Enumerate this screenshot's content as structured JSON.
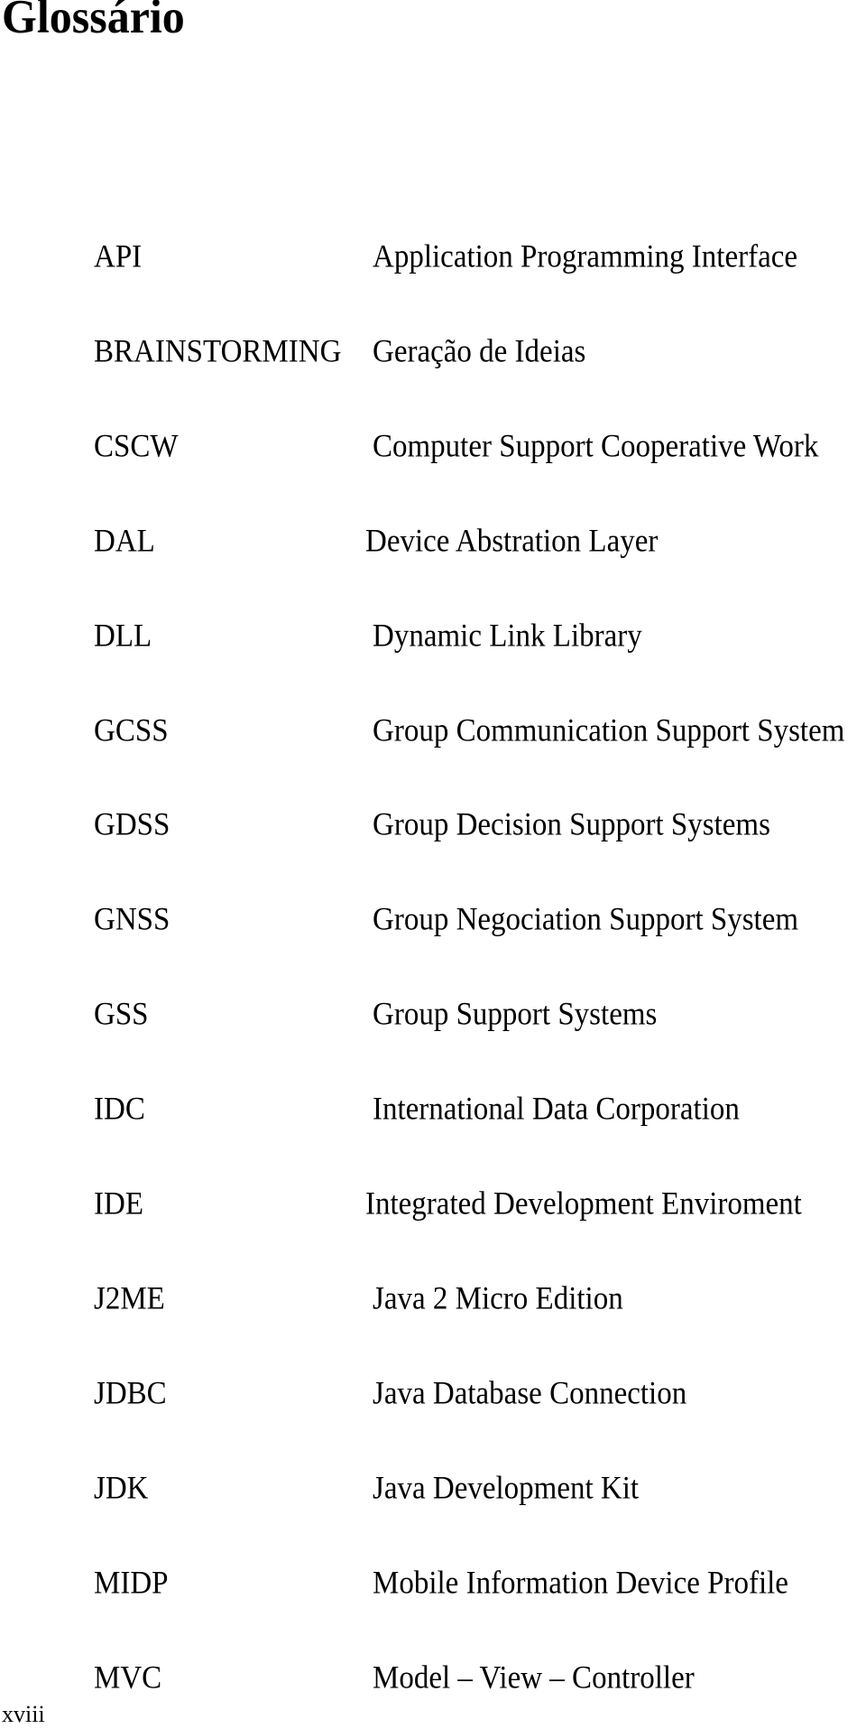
{
  "page": {
    "title": "Glossário",
    "page_number": "xviii"
  },
  "glossary": [
    {
      "term": "API",
      "definition": "Application Programming Interface"
    },
    {
      "term": "BRAINSTORMING",
      "definition": "Geração de Ideias"
    },
    {
      "term": "CSCW",
      "definition": "Computer Support Cooperative Work"
    },
    {
      "term": "DAL",
      "definition": "Device Abstration Layer"
    },
    {
      "term": "DLL",
      "definition": "Dynamic Link Library"
    },
    {
      "term": "GCSS",
      "definition": "Group Communication Support System"
    },
    {
      "term": "GDSS",
      "definition": "Group Decision Support Systems"
    },
    {
      "term": "GNSS",
      "definition": "Group Negociation Support System"
    },
    {
      "term": "GSS",
      "definition": "Group Support Systems"
    },
    {
      "term": "IDC",
      "definition": "International Data Corporation"
    },
    {
      "term": "IDE",
      "definition": "Integrated Development Enviroment"
    },
    {
      "term": "J2ME",
      "definition": "Java 2 Micro Edition"
    },
    {
      "term": "JDBC",
      "definition": "Java Database Connection"
    },
    {
      "term": "JDK",
      "definition": "Java Development Kit"
    },
    {
      "term": "MIDP",
      "definition": "Mobile Information Device Profile"
    },
    {
      "term": "MVC",
      "definition": "Model – View – Controller"
    }
  ]
}
